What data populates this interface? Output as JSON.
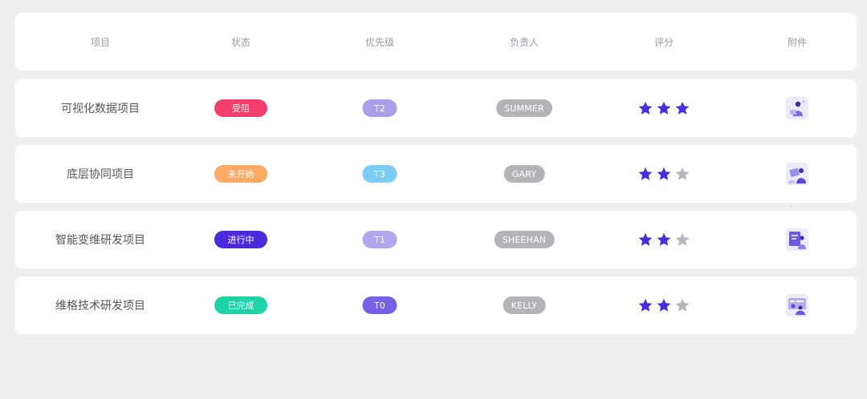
{
  "columns": {
    "project": "项目",
    "status": "状态",
    "priority": "优先级",
    "owner": "负责人",
    "rating": "评分",
    "attachment": "附件"
  },
  "rows": [
    {
      "project": "可视化数据项目",
      "status": "受阻",
      "status_color": "#f23e6b",
      "priority": "T2",
      "priority_color": "#a99fe8",
      "owner": "SUMMER",
      "rating": 3,
      "attachment_icon": "person-working-illustration-icon"
    },
    {
      "project": "底层协同项目",
      "status": "未开始",
      "status_color": "#fcaa63",
      "priority": "T3",
      "priority_color": "#7ccdf4",
      "owner": "GARY",
      "rating": 2,
      "attachment_icon": "team-collaboration-illustration-icon"
    },
    {
      "project": "智能变维研发项目",
      "status": "进行中",
      "status_color": "#4b2ad9",
      "priority": "T1",
      "priority_color": "#b1a6ec",
      "owner": "SHEEHAN",
      "rating": 2,
      "attachment_icon": "presentation-board-illustration-icon"
    },
    {
      "project": "维格技术研发项目",
      "status": "已完成",
      "status_color": "#1fd3a6",
      "priority": "T0",
      "priority_color": "#7660e6",
      "owner": "KELLY",
      "rating": 2,
      "attachment_icon": "dashboard-screen-illustration-icon"
    }
  ],
  "rating_max": 3,
  "colors": {
    "star_filled": "#4a2edc",
    "star_empty": "#b7b7bb",
    "owner_pill": "#b4b4b8"
  }
}
